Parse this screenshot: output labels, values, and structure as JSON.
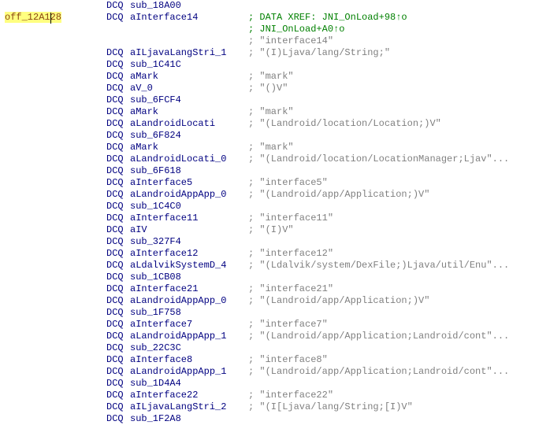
{
  "lines": [
    {
      "label": "",
      "mnemonic": "DCQ",
      "operand": "sub_18A00",
      "comment": "",
      "commentType": "normal"
    },
    {
      "label": "off_12A128",
      "labelHighlight": true,
      "mnemonic": "DCQ",
      "operand": "aInterface14",
      "comment": "; DATA XREF: JNI_OnLoad+98↑o",
      "commentType": "xref"
    },
    {
      "label": "",
      "mnemonic": "",
      "operand": "",
      "comment": "; JNI_OnLoad+A0↑o",
      "commentType": "xref"
    },
    {
      "label": "",
      "mnemonic": "",
      "operand": "",
      "comment": "; \"interface14\"",
      "commentType": "normal"
    },
    {
      "label": "",
      "mnemonic": "DCQ",
      "operand": "aILjavaLangStri_1",
      "comment": "; \"(I)Ljava/lang/String;\"",
      "commentType": "normal"
    },
    {
      "label": "",
      "mnemonic": "DCQ",
      "operand": "sub_1C41C",
      "comment": "",
      "commentType": "normal"
    },
    {
      "label": "",
      "mnemonic": "DCQ",
      "operand": "aMark",
      "comment": "; \"mark\"",
      "commentType": "normal"
    },
    {
      "label": "",
      "mnemonic": "DCQ",
      "operand": "aV_0",
      "comment": "; \"()V\"",
      "commentType": "normal"
    },
    {
      "label": "",
      "mnemonic": "DCQ",
      "operand": "sub_6FCF4",
      "comment": "",
      "commentType": "normal"
    },
    {
      "label": "",
      "mnemonic": "DCQ",
      "operand": "aMark",
      "comment": "; \"mark\"",
      "commentType": "normal"
    },
    {
      "label": "",
      "mnemonic": "DCQ",
      "operand": "aLandroidLocati",
      "comment": "; \"(Landroid/location/Location;)V\"",
      "commentType": "normal"
    },
    {
      "label": "",
      "mnemonic": "DCQ",
      "operand": "sub_6F824",
      "comment": "",
      "commentType": "normal"
    },
    {
      "label": "",
      "mnemonic": "DCQ",
      "operand": "aMark",
      "comment": "; \"mark\"",
      "commentType": "normal"
    },
    {
      "label": "",
      "mnemonic": "DCQ",
      "operand": "aLandroidLocati_0",
      "comment": "; \"(Landroid/location/LocationManager;Ljav\"...",
      "commentType": "normal"
    },
    {
      "label": "",
      "mnemonic": "DCQ",
      "operand": "sub_6F618",
      "comment": "",
      "commentType": "normal"
    },
    {
      "label": "",
      "mnemonic": "DCQ",
      "operand": "aInterface5",
      "comment": "; \"interface5\"",
      "commentType": "normal"
    },
    {
      "label": "",
      "mnemonic": "DCQ",
      "operand": "aLandroidAppApp_0",
      "comment": "; \"(Landroid/app/Application;)V\"",
      "commentType": "normal"
    },
    {
      "label": "",
      "mnemonic": "DCQ",
      "operand": "sub_1C4C0",
      "comment": "",
      "commentType": "normal"
    },
    {
      "label": "",
      "mnemonic": "DCQ",
      "operand": "aInterface11",
      "comment": "; \"interface11\"",
      "commentType": "normal"
    },
    {
      "label": "",
      "mnemonic": "DCQ",
      "operand": "aIV",
      "comment": "; \"(I)V\"",
      "commentType": "normal"
    },
    {
      "label": "",
      "mnemonic": "DCQ",
      "operand": "sub_327F4",
      "comment": "",
      "commentType": "normal"
    },
    {
      "label": "",
      "mnemonic": "DCQ",
      "operand": "aInterface12",
      "comment": "; \"interface12\"",
      "commentType": "normal"
    },
    {
      "label": "",
      "mnemonic": "DCQ",
      "operand": "aLdalvikSystemD_4",
      "comment": "; \"(Ldalvik/system/DexFile;)Ljava/util/Enu\"...",
      "commentType": "normal"
    },
    {
      "label": "",
      "mnemonic": "DCQ",
      "operand": "sub_1CB08",
      "comment": "",
      "commentType": "normal"
    },
    {
      "label": "",
      "mnemonic": "DCQ",
      "operand": "aInterface21",
      "comment": "; \"interface21\"",
      "commentType": "normal"
    },
    {
      "label": "",
      "mnemonic": "DCQ",
      "operand": "aLandroidAppApp_0",
      "comment": "; \"(Landroid/app/Application;)V\"",
      "commentType": "normal"
    },
    {
      "label": "",
      "mnemonic": "DCQ",
      "operand": "sub_1F758",
      "comment": "",
      "commentType": "normal"
    },
    {
      "label": "",
      "mnemonic": "DCQ",
      "operand": "aInterface7",
      "comment": "; \"interface7\"",
      "commentType": "normal"
    },
    {
      "label": "",
      "mnemonic": "DCQ",
      "operand": "aLandroidAppApp_1",
      "comment": "; \"(Landroid/app/Application;Landroid/cont\"...",
      "commentType": "normal"
    },
    {
      "label": "",
      "mnemonic": "DCQ",
      "operand": "sub_22C3C",
      "comment": "",
      "commentType": "normal"
    },
    {
      "label": "",
      "mnemonic": "DCQ",
      "operand": "aInterface8",
      "comment": "; \"interface8\"",
      "commentType": "normal"
    },
    {
      "label": "",
      "mnemonic": "DCQ",
      "operand": "aLandroidAppApp_1",
      "comment": "; \"(Landroid/app/Application;Landroid/cont\"...",
      "commentType": "normal"
    },
    {
      "label": "",
      "mnemonic": "DCQ",
      "operand": "sub_1D4A4",
      "comment": "",
      "commentType": "normal"
    },
    {
      "label": "",
      "mnemonic": "DCQ",
      "operand": "aInterface22",
      "comment": "; \"interface22\"",
      "commentType": "normal"
    },
    {
      "label": "",
      "mnemonic": "DCQ",
      "operand": "aILjavaLangStri_2",
      "comment": "; \"(I[Ljava/lang/String;[I)V\"",
      "commentType": "normal"
    },
    {
      "label": "",
      "mnemonic": "DCQ",
      "operand": "sub_1F2A8",
      "comment": "",
      "commentType": "normal"
    }
  ]
}
